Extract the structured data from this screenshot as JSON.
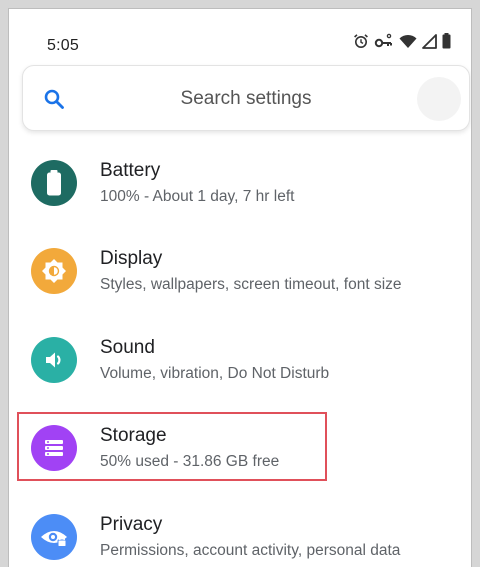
{
  "status_bar": {
    "time": "5:05",
    "icons": [
      "alarm-icon",
      "vpn-key-icon",
      "wifi-icon",
      "signal-icon",
      "battery-icon"
    ]
  },
  "search": {
    "placeholder": "Search settings"
  },
  "settings": [
    {
      "id": "battery",
      "title": "Battery",
      "subtitle": "100% - About 1 day, 7 hr left",
      "icon": "battery-icon",
      "color": "#1e6b62"
    },
    {
      "id": "display",
      "title": "Display",
      "subtitle": "Styles, wallpapers, screen timeout, font size",
      "icon": "brightness-icon",
      "color": "#f2a93b"
    },
    {
      "id": "sound",
      "title": "Sound",
      "subtitle": "Volume, vibration, Do Not Disturb",
      "icon": "volume-icon",
      "color": "#2ab0a5"
    },
    {
      "id": "storage",
      "title": "Storage",
      "subtitle": "50% used - 31.86 GB free",
      "icon": "storage-icon",
      "color": "#a142f4",
      "highlighted": true
    },
    {
      "id": "privacy",
      "title": "Privacy",
      "subtitle": "Permissions, account activity, personal data",
      "icon": "privacy-eye-icon",
      "color": "#4c8df6"
    }
  ],
  "colors": {
    "highlight": "#e0505a"
  }
}
